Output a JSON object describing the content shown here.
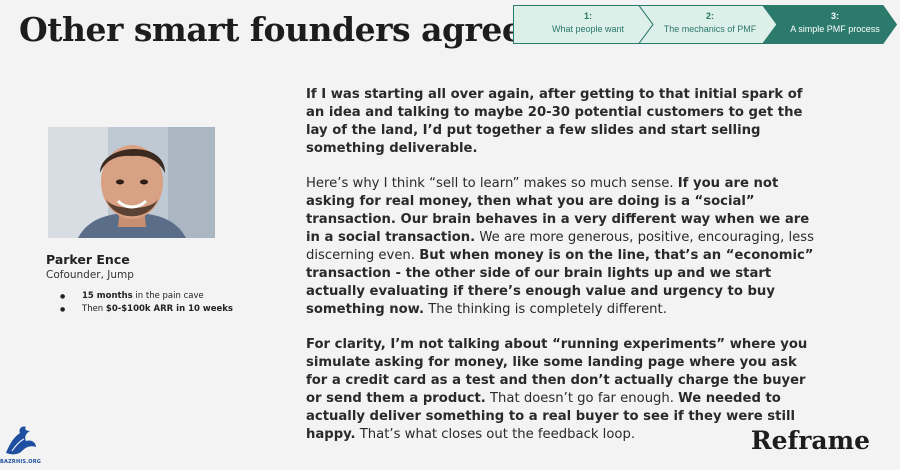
{
  "slide": {
    "title": "Other smart founders agree",
    "brand": "Reframe",
    "watermark": "BAZRHIS.ORG"
  },
  "stepper": {
    "steps": [
      {
        "number": "1:",
        "label": "What people want",
        "state": "inactive"
      },
      {
        "number": "2:",
        "label": "The mechanics of PMF",
        "state": "inactive"
      },
      {
        "number": "3:",
        "label": "A simple PMF process",
        "state": "active"
      }
    ],
    "colors": {
      "active_fill": "#2b7a6b",
      "inactive_fill": "#ddefe9",
      "border": "#2b7a6b"
    }
  },
  "profile": {
    "name": "Parker Ence",
    "role": "Cofounder, Jump",
    "photo_icon": "person-photo",
    "bullets": [
      {
        "bold": "15 months",
        "rest": " in the pain cave"
      },
      {
        "prefix": "Then ",
        "bold": "$0-$100k ARR in 10 weeks"
      }
    ]
  },
  "quote": {
    "p1_b1": "If I was starting all over again, after getting to that initial spark of an idea and talking to maybe 20-30 potential customers to get the lay of the land, I’d put together a few slides and start selling something deliverable.",
    "p2_t1": "Here’s why I think “sell to learn” makes so much sense. ",
    "p2_b1": "If you are not asking for real money, then what you are doing is a “social” transaction. Our brain behaves in a very different way when we are in a social transaction.",
    "p2_t2": " We are more generous, positive, encouraging, less discerning even. ",
    "p2_b2": "But when money is on the line, that’s an “economic” transaction - the other side of our brain lights up and we start actually evaluating if there’s enough value and urgency to buy something now.",
    "p2_t3": " The thinking is completely different.",
    "p3_b1": "For clarity, I’m not talking about “running experiments” where you simulate asking for money, like some landing page where you ask for a credit card as a test and then don’t actually charge the buyer or send them a product.",
    "p3_t1": " That doesn’t go far enough. ",
    "p3_b2": "We needed to actually deliver something to a real buyer to see if they were still happy.",
    "p3_t2": " That’s what closes out the feedback loop."
  }
}
